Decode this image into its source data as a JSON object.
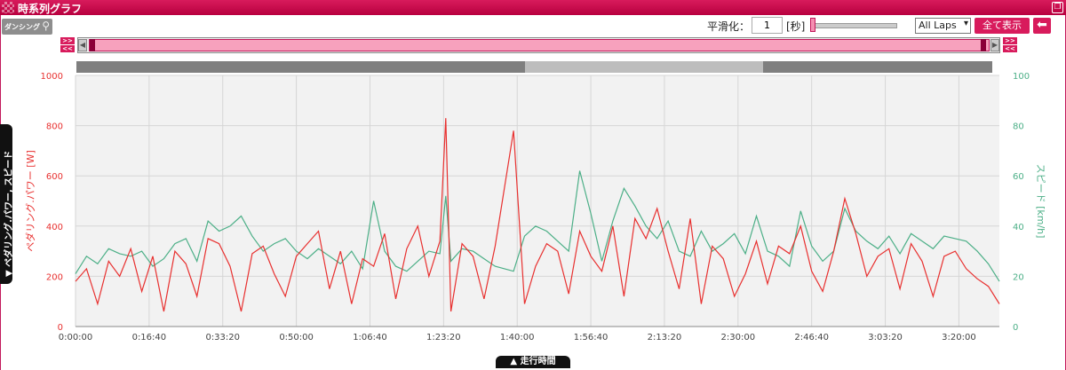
{
  "window": {
    "title": "時系列グラフ",
    "restore_icon": "restore-icon"
  },
  "logo": {
    "text": "ダンシング",
    "icon": "cyclist-icon"
  },
  "toolbar": {
    "smoothing_label": "平滑化：",
    "smoothing_value": "1",
    "smoothing_unit": "[秒]",
    "laps_selected": "All Laps",
    "show_all_label": "全て表示",
    "back_icon": "back-arrow-icon"
  },
  "range": {
    "right_label": ">>",
    "left_label": "<<"
  },
  "laps_bar": {
    "segments": [
      {
        "start": 0,
        "end": 0.49,
        "color": "#7f7f7f"
      },
      {
        "start": 0.49,
        "end": 0.75,
        "color": "#bdbdbd"
      },
      {
        "start": 0.75,
        "end": 1.0,
        "color": "#7f7f7f"
      }
    ]
  },
  "side_tab": {
    "label": "▼ ペダリング.パワー, スピード"
  },
  "bottom_tab": {
    "label": "▲ 走行時間"
  },
  "colors": {
    "power": "#e8302f",
    "speed": "#4caf87",
    "accent": "#d81b5c"
  },
  "chart_data": {
    "type": "line",
    "xlabel": "",
    "ylabel_left": "ペダリング.パワー [W]",
    "ylabel_right": "スピード [km/h]",
    "ylim_left": [
      0,
      1000
    ],
    "ylim_right": [
      0,
      100
    ],
    "yticks_left": [
      "0",
      "200",
      "400",
      "600",
      "800",
      "1000"
    ],
    "yticks_right": [
      "0",
      "20",
      "40",
      "60",
      "80",
      "100"
    ],
    "xticks": [
      "0:00:00",
      "0:16:40",
      "0:33:20",
      "0:50:00",
      "1:06:40",
      "1:23:20",
      "1:40:00",
      "1:56:40",
      "2:13:20",
      "2:30:00",
      "2:46:40",
      "3:03:20",
      "3:20:00"
    ],
    "xtick_seconds": [
      0,
      1000,
      2000,
      3000,
      4000,
      5000,
      6000,
      7000,
      8000,
      9000,
      10000,
      11000,
      12000
    ],
    "x_range_seconds": [
      0,
      12550
    ],
    "grid": true,
    "series": [
      {
        "name": "ペダリング.パワー [W]",
        "axis": "left",
        "x": [
          0,
          150,
          300,
          450,
          600,
          750,
          900,
          1050,
          1200,
          1350,
          1500,
          1650,
          1800,
          1950,
          2100,
          2250,
          2400,
          2550,
          2700,
          2850,
          3000,
          3150,
          3300,
          3450,
          3600,
          3750,
          3900,
          4050,
          4200,
          4350,
          4500,
          4650,
          4800,
          4950,
          5030,
          5100,
          5250,
          5400,
          5550,
          5700,
          5950,
          6100,
          6250,
          6400,
          6550,
          6700,
          6850,
          7000,
          7150,
          7300,
          7450,
          7600,
          7750,
          7900,
          8050,
          8200,
          8350,
          8500,
          8650,
          8800,
          8950,
          9100,
          9250,
          9400,
          9550,
          9700,
          9850,
          10000,
          10150,
          10300,
          10450,
          10600,
          10750,
          10900,
          11050,
          11200,
          11350,
          11500,
          11650,
          11800,
          11950,
          12100,
          12250,
          12400,
          12550
        ],
        "y": [
          180,
          230,
          90,
          260,
          200,
          310,
          140,
          280,
          60,
          300,
          250,
          120,
          350,
          330,
          240,
          60,
          290,
          320,
          210,
          120,
          280,
          330,
          380,
          150,
          300,
          90,
          270,
          240,
          370,
          110,
          310,
          400,
          200,
          340,
          830,
          60,
          330,
          280,
          110,
          320,
          780,
          90,
          240,
          330,
          300,
          130,
          380,
          280,
          220,
          400,
          120,
          430,
          350,
          470,
          300,
          150,
          430,
          90,
          320,
          270,
          120,
          210,
          340,
          170,
          320,
          290,
          400,
          220,
          140,
          300,
          510,
          370,
          200,
          280,
          310,
          150,
          330,
          260,
          120,
          280,
          300,
          230,
          190,
          160,
          90
        ]
      },
      {
        "name": "スピード [km/h]",
        "axis": "right",
        "x": [
          0,
          150,
          300,
          450,
          600,
          750,
          900,
          1050,
          1200,
          1350,
          1500,
          1650,
          1800,
          1950,
          2100,
          2250,
          2400,
          2550,
          2700,
          2850,
          3000,
          3150,
          3300,
          3450,
          3600,
          3750,
          3900,
          4050,
          4200,
          4350,
          4500,
          4650,
          4800,
          4950,
          5030,
          5100,
          5250,
          5400,
          5550,
          5700,
          5950,
          6100,
          6250,
          6400,
          6550,
          6700,
          6850,
          7000,
          7150,
          7300,
          7450,
          7600,
          7750,
          7900,
          8050,
          8200,
          8350,
          8500,
          8650,
          8800,
          8950,
          9100,
          9250,
          9400,
          9550,
          9700,
          9850,
          10000,
          10150,
          10300,
          10450,
          10600,
          10750,
          10900,
          11050,
          11200,
          11350,
          11500,
          11650,
          11800,
          11950,
          12100,
          12250,
          12400,
          12550
        ],
        "y": [
          21,
          28,
          25,
          31,
          29,
          28,
          30,
          24,
          27,
          33,
          35,
          26,
          42,
          38,
          40,
          44,
          36,
          30,
          33,
          35,
          30,
          27,
          31,
          28,
          25,
          30,
          23,
          50,
          30,
          24,
          22,
          26,
          30,
          29,
          52,
          26,
          31,
          30,
          27,
          24,
          22,
          36,
          40,
          38,
          34,
          30,
          62,
          45,
          26,
          42,
          55,
          48,
          40,
          35,
          42,
          30,
          28,
          38,
          30,
          33,
          37,
          29,
          44,
          30,
          28,
          24,
          46,
          32,
          26,
          30,
          47,
          38,
          34,
          31,
          36,
          29,
          37,
          34,
          31,
          36,
          35,
          34,
          30,
          25,
          18
        ]
      }
    ]
  }
}
